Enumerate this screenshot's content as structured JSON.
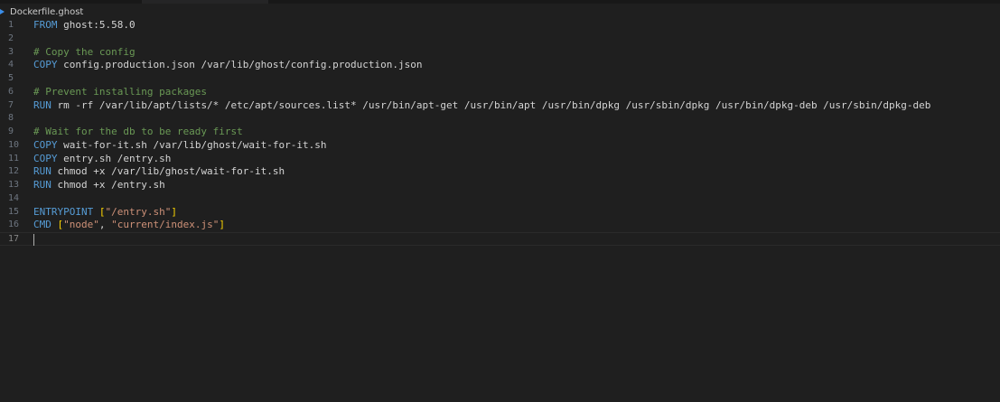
{
  "breadcrumb": {
    "filename": "Dockerfile.ghost",
    "icon": "docker-file-icon",
    "icon_color": "#3b8eea"
  },
  "colors": {
    "background": "#1f1f1f",
    "keyword": "#569cd6",
    "comment": "#6a9955",
    "string": "#ce9178",
    "bracket": "#ffd700",
    "text": "#d4d4d4",
    "line_number": "#6e7681"
  },
  "editor": {
    "lines": [
      {
        "n": "1",
        "tokens": [
          {
            "t": "kw",
            "v": "FROM"
          },
          {
            "t": "tx",
            "v": " ghost:5.58.0"
          }
        ]
      },
      {
        "n": "2",
        "tokens": []
      },
      {
        "n": "3",
        "tokens": [
          {
            "t": "cm",
            "v": "# Copy the config"
          }
        ]
      },
      {
        "n": "4",
        "tokens": [
          {
            "t": "kw",
            "v": "COPY"
          },
          {
            "t": "tx",
            "v": " config.production.json /var/lib/ghost/config.production.json"
          }
        ]
      },
      {
        "n": "5",
        "tokens": []
      },
      {
        "n": "6",
        "tokens": [
          {
            "t": "cm",
            "v": "# Prevent installing packages"
          }
        ]
      },
      {
        "n": "7",
        "tokens": [
          {
            "t": "kw",
            "v": "RUN"
          },
          {
            "t": "tx",
            "v": " rm -rf /var/lib/apt/lists/* /etc/apt/sources.list* /usr/bin/apt-get /usr/bin/apt /usr/bin/dpkg /usr/sbin/dpkg /usr/bin/dpkg-deb /usr/sbin/dpkg-deb"
          }
        ]
      },
      {
        "n": "8",
        "tokens": []
      },
      {
        "n": "9",
        "tokens": [
          {
            "t": "cm",
            "v": "# Wait for the db to be ready first"
          }
        ]
      },
      {
        "n": "10",
        "tokens": [
          {
            "t": "kw",
            "v": "COPY"
          },
          {
            "t": "tx",
            "v": " wait-for-it.sh /var/lib/ghost/wait-for-it.sh"
          }
        ]
      },
      {
        "n": "11",
        "tokens": [
          {
            "t": "kw",
            "v": "COPY"
          },
          {
            "t": "tx",
            "v": " entry.sh /entry.sh"
          }
        ]
      },
      {
        "n": "12",
        "tokens": [
          {
            "t": "kw",
            "v": "RUN"
          },
          {
            "t": "tx",
            "v": " chmod +x /var/lib/ghost/wait-for-it.sh"
          }
        ]
      },
      {
        "n": "13",
        "tokens": [
          {
            "t": "kw",
            "v": "RUN"
          },
          {
            "t": "tx",
            "v": " chmod +x /entry.sh"
          }
        ]
      },
      {
        "n": "14",
        "tokens": []
      },
      {
        "n": "15",
        "tokens": [
          {
            "t": "kw",
            "v": "ENTRYPOINT"
          },
          {
            "t": "tx",
            "v": " "
          },
          {
            "t": "br",
            "v": "["
          },
          {
            "t": "st",
            "v": "\"/entry.sh\""
          },
          {
            "t": "br",
            "v": "]"
          }
        ]
      },
      {
        "n": "16",
        "tokens": [
          {
            "t": "kw",
            "v": "CMD"
          },
          {
            "t": "tx",
            "v": " "
          },
          {
            "t": "br",
            "v": "["
          },
          {
            "t": "st",
            "v": "\"node\""
          },
          {
            "t": "tx",
            "v": ", "
          },
          {
            "t": "st",
            "v": "\"current/index.js\""
          },
          {
            "t": "br",
            "v": "]"
          }
        ]
      },
      {
        "n": "17",
        "tokens": [],
        "current": true
      }
    ]
  }
}
